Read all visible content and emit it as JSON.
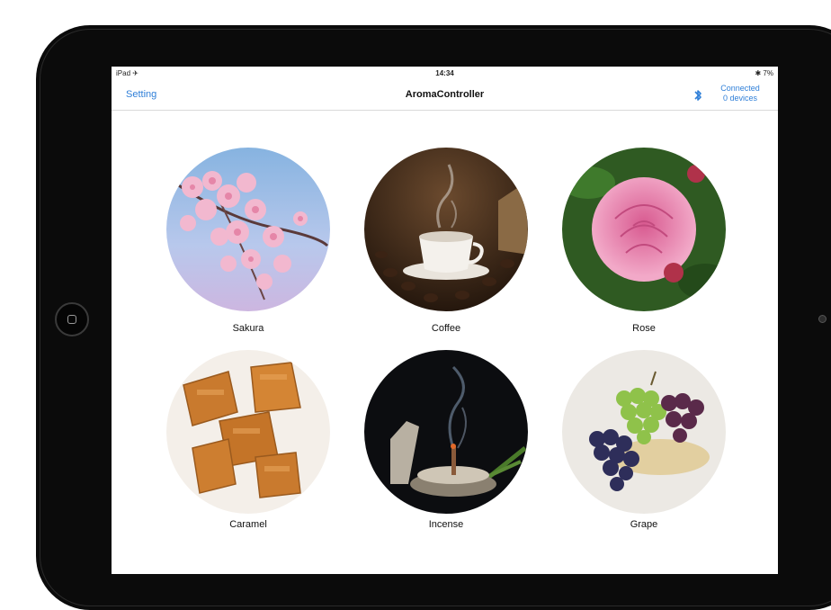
{
  "status_bar": {
    "carrier": "iPad ✈︎",
    "time": "14:34",
    "battery": "✱ 7%"
  },
  "nav": {
    "left_button": "Setting",
    "title": "AromaController",
    "connection_line1": "Connected",
    "connection_line2": "0 devices"
  },
  "aromas": [
    {
      "label": "Sakura"
    },
    {
      "label": "Coffee"
    },
    {
      "label": "Rose"
    },
    {
      "label": "Caramel"
    },
    {
      "label": "Incense"
    },
    {
      "label": "Grape"
    }
  ],
  "colors": {
    "accent": "#2f7fd8",
    "device_frame": "#0b0b0b"
  }
}
